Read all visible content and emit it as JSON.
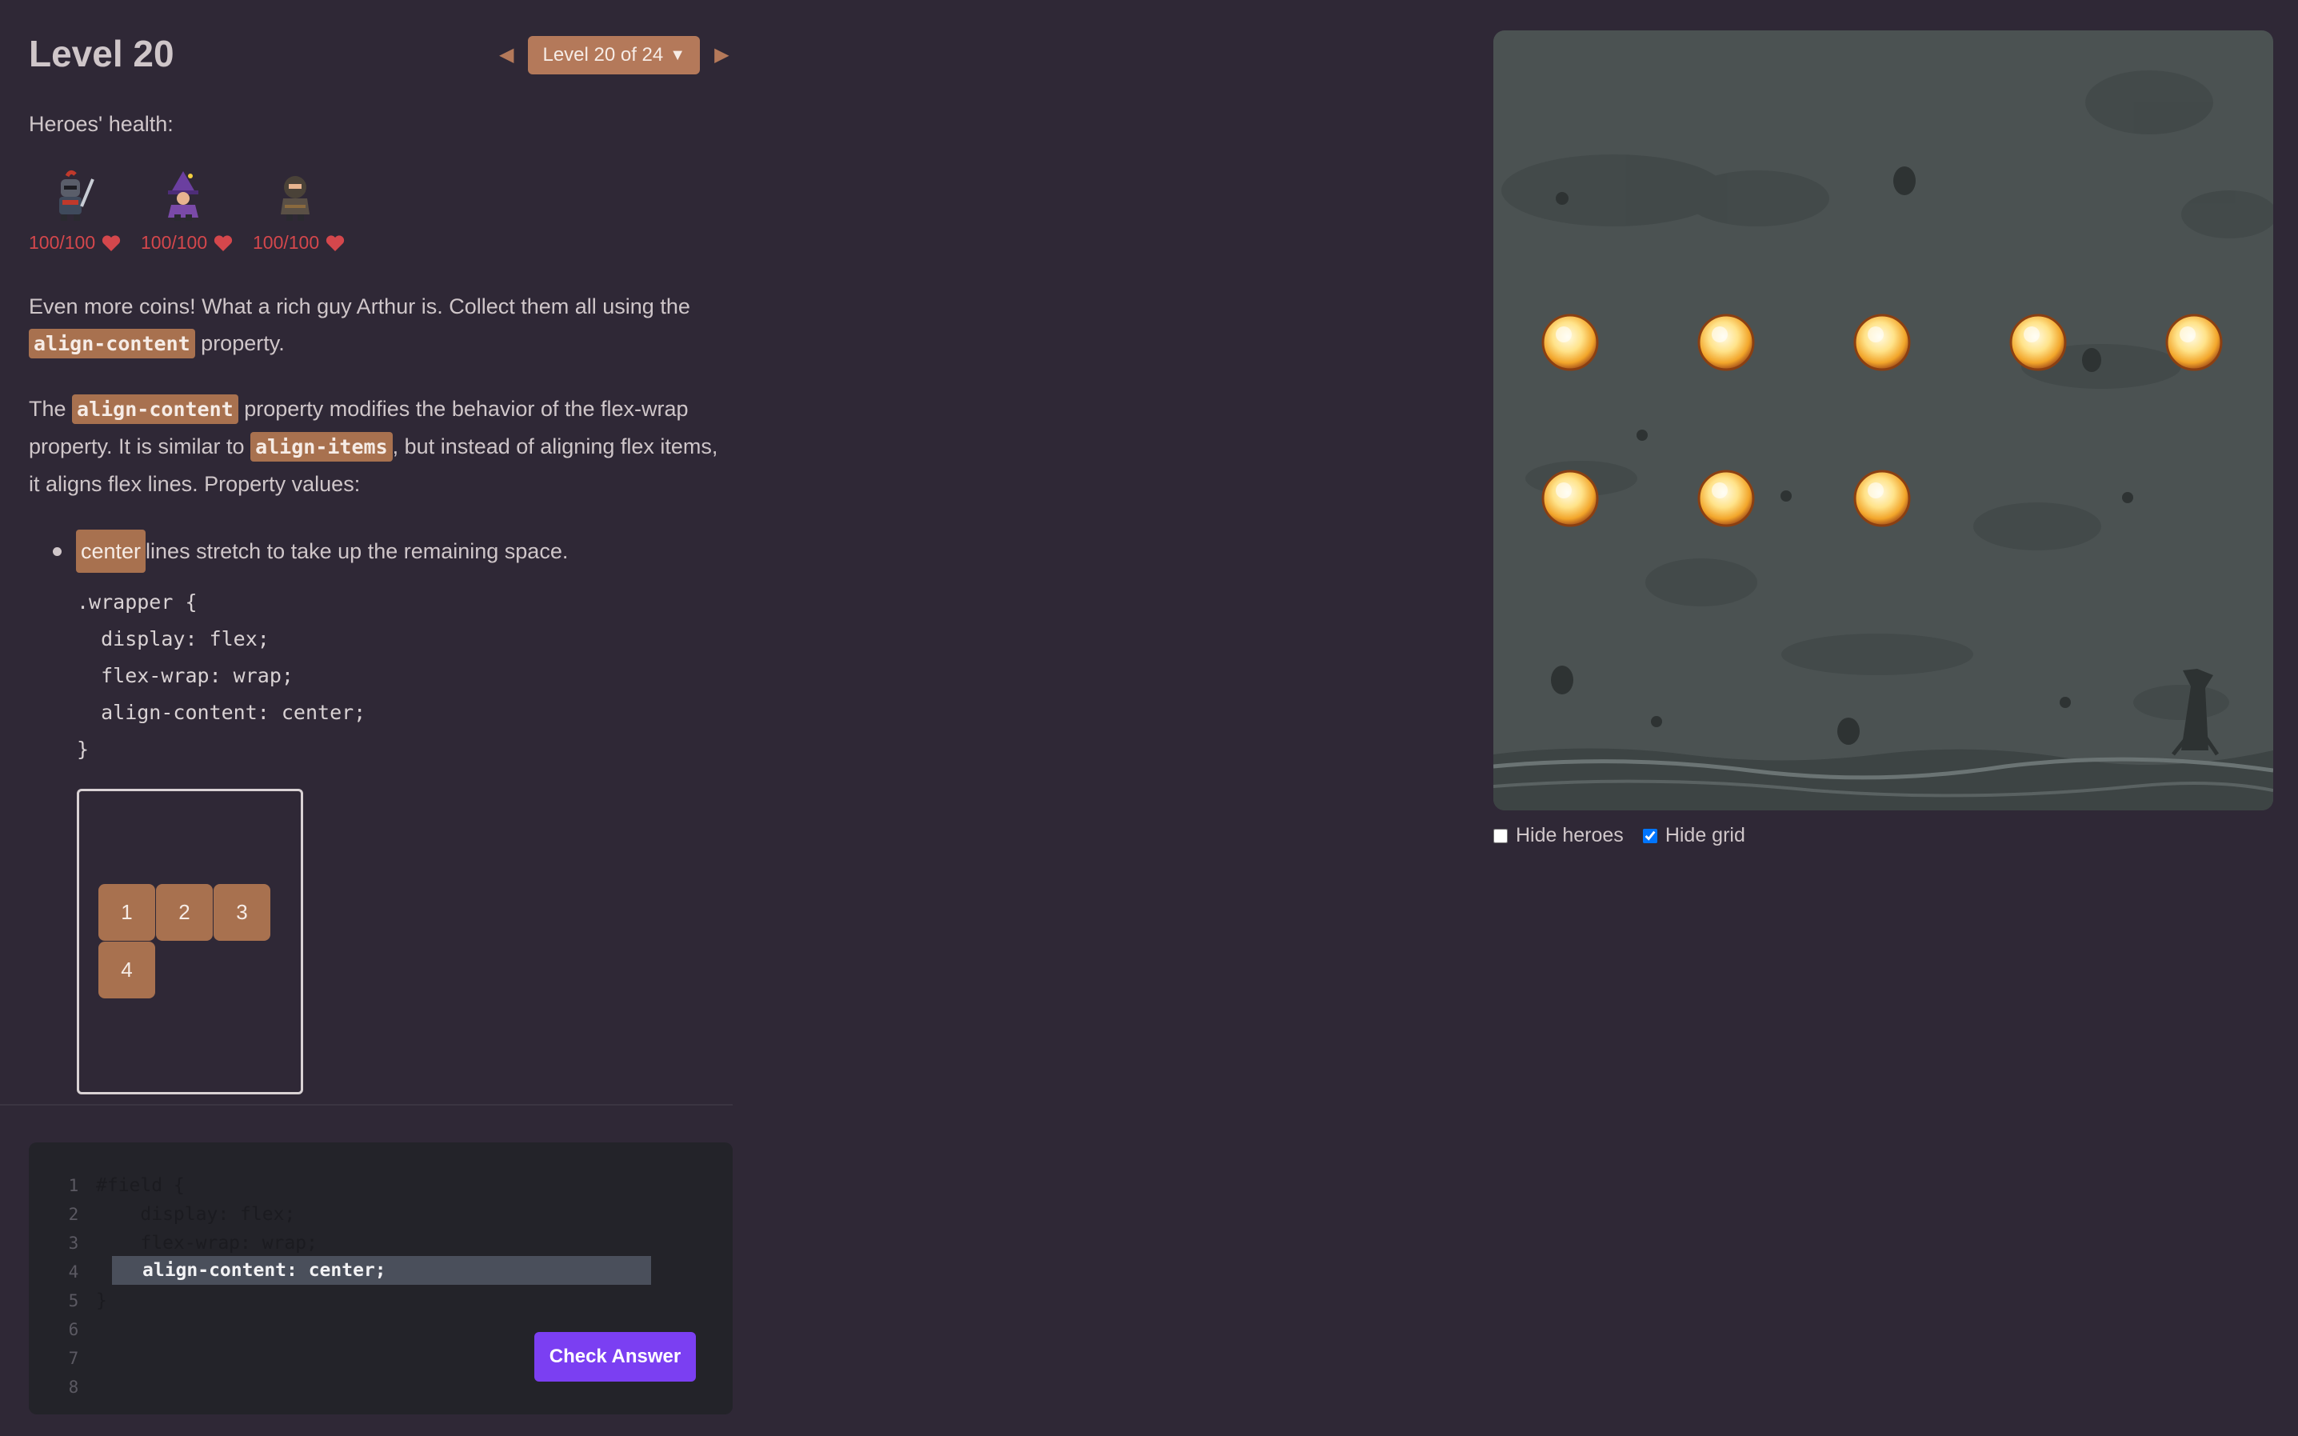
{
  "level": {
    "title": "Level 20",
    "selector_label": "Level 20 of 24",
    "prev_symbol": "◀",
    "next_symbol": "▶",
    "caret_symbol": "▼"
  },
  "heroes": {
    "heading": "Heroes' health:",
    "list": [
      {
        "name": "knight-icon",
        "health": "100/100"
      },
      {
        "name": "mage-icon",
        "health": "100/100"
      },
      {
        "name": "rogue-icon",
        "health": "100/100"
      }
    ]
  },
  "description": {
    "p1_text_a": "Even more coins! What a rich guy Arthur is. Collect them all using the",
    "p1_code": "align-content",
    "p1_text_b": " property.",
    "p2_text_a": "The ",
    "p2_code_a": "align-content",
    "p2_text_b": " property modifies the behavior of the flex-wrap property. It is similar to ",
    "p2_code_b": "align-items",
    "p2_text_c": ", but instead of aligning flex items, it aligns flex lines. Property values:",
    "bullet_code": "center",
    "bullet_text": " lines stretch to take up the remaining space."
  },
  "example_code": [
    ".wrapper {",
    "  display: flex;",
    "  flex-wrap: wrap;",
    "  align-content: center;",
    "}"
  ],
  "demo_items": [
    "1",
    "2",
    "3",
    "4"
  ],
  "editor": {
    "line_numbers": [
      "1",
      "2",
      "3",
      "4",
      "5",
      "6",
      "7",
      "8"
    ],
    "lines": [
      "#field {",
      "    display: flex;",
      "    flex-wrap: wrap;",
      "",
      "}",
      "",
      "",
      ""
    ],
    "input_value": "align-content: center;",
    "check_label": "Check Answer"
  },
  "options": {
    "hide_heroes": {
      "label": "Hide heroes",
      "checked": false
    },
    "hide_grid": {
      "label": "Hide grid",
      "checked": true
    }
  },
  "colors": {
    "background": "#2f2836",
    "accent": "#a8714f",
    "button": "#7b3ff2",
    "health": "#d4474c"
  }
}
